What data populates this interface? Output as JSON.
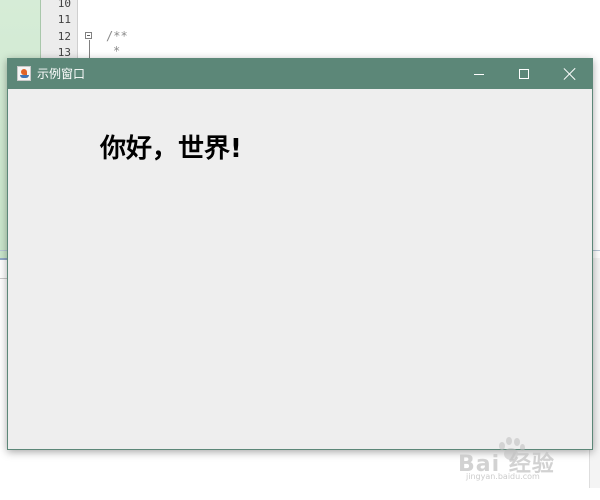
{
  "ide": {
    "line_numbers": [
      "10",
      "11",
      "12",
      "13"
    ],
    "code_lines": [
      "/**",
      "*"
    ]
  },
  "window": {
    "title": "示例窗口",
    "app_icon": "java-icon",
    "controls": {
      "minimize_icon": "minimize-icon",
      "maximize_icon": "maximize-icon",
      "close_icon": "close-icon"
    },
    "title_bar_color": "#5c8778",
    "background_color": "#eeeeee",
    "label": "你好，世界!"
  },
  "watermark": {
    "brand": "Bai 经验",
    "url": "jingyan.baidu.com"
  }
}
